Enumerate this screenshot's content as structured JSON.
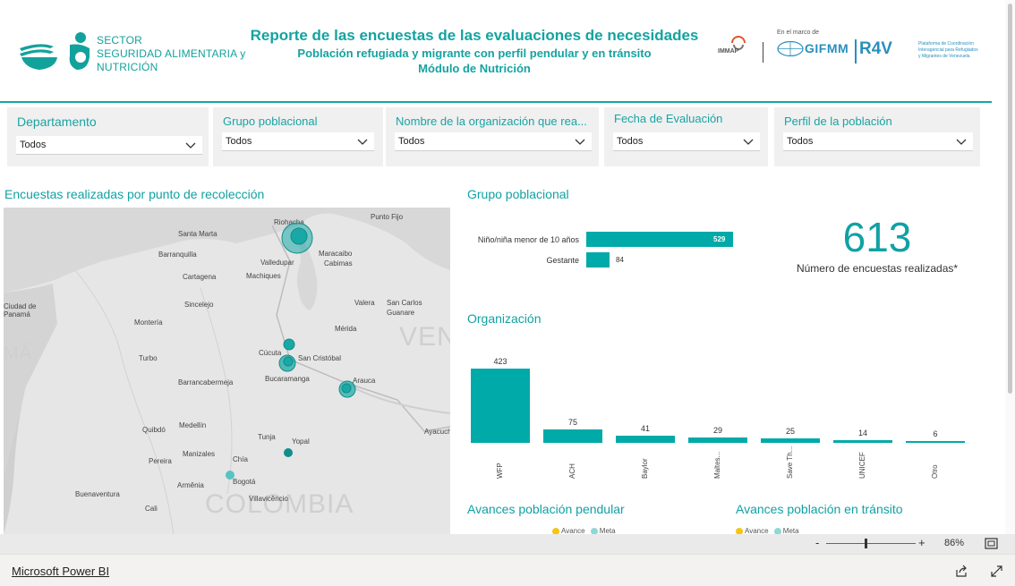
{
  "header": {
    "sector_line1": "SECTOR",
    "sector_line2": "SEGURIDAD ALIMENTARIA y",
    "sector_line3": "NUTRICIÓN",
    "title": "Reporte de las encuestas de las evaluaciones de necesidades",
    "subtitle1": "Población refugiada y migrante con perfil pendular y en tránsito",
    "subtitle2": "Módulo de Nutrición",
    "immap": "IMMAP",
    "en_el_marco": "En el marco de",
    "gifmm": "GIFMM",
    "r4v": "R4V",
    "r4v_sub": "Plataforma de Coordinación Interagencial para Refugiados y Migrantes de Venezuela",
    "brand_color": "#11a3a6"
  },
  "slicers": [
    {
      "title": "Departamento",
      "value": "Todos"
    },
    {
      "title": "Grupo poblacional",
      "value": "Todos"
    },
    {
      "title": "Nombre de la organización que rea...",
      "value": "Todos"
    },
    {
      "title": "Fecha de Evaluación",
      "value": "Todos"
    },
    {
      "title": "Perfil de la población",
      "value": "Todos"
    }
  ],
  "map": {
    "title": "Encuestas realizadas por punto de recolección",
    "cities": [
      "Riohacha",
      "Punto Fijo",
      "Santa Marta",
      "Barranquilla",
      "Maracaibo",
      "Cabimas",
      "Valledupar",
      "Cartagena",
      "Machiques",
      "Ciudad de Panamá",
      "Sincelejo",
      "Valera",
      "San Carlos",
      "Guanare",
      "Montería",
      "Mérida",
      "Cúcuta",
      "Turbo",
      "San Cristóbal",
      "Barrancabermeja",
      "Bucaramanga",
      "Arauca",
      "Quibdó",
      "Medellín",
      "Tunja",
      "Yopal",
      "Ayacucho",
      "Manizales",
      "Pereira",
      "Chía",
      "Bogotá",
      "Armênia",
      "Villavicêncio",
      "Buenaventura",
      "Cali"
    ],
    "country_labels": [
      "COLOMBIA",
      "VEN",
      "MÁ"
    ]
  },
  "grupo": {
    "title": "Grupo poblacional",
    "categories": [
      "Niño/niña menor de 10 años",
      "Gestante"
    ],
    "values": [
      529,
      84
    ]
  },
  "kpi": {
    "value": "613",
    "label": "Número de encuestas realizadas*"
  },
  "org": {
    "title": "Organización"
  },
  "chart_data": {
    "type": "bar",
    "categories": [
      "WFP",
      "ACH",
      "Baylor",
      "Maltes...",
      "Save Th...",
      "UNICEF",
      "Otro"
    ],
    "values": [
      423,
      75,
      41,
      29,
      25,
      14,
      6
    ],
    "title": "Organización",
    "xlabel": "",
    "ylabel": "",
    "color": "#00aaa8"
  },
  "avances": {
    "pendular_title": "Avances población pendular",
    "transito_title": "Avances población en tránsito",
    "legend_avance": "Avance",
    "legend_meta": "Meta",
    "avance_color": "#f5c518",
    "meta_color": "#8dd9d6"
  },
  "zoom": {
    "minus": "-",
    "plus": "+",
    "level": "86%"
  },
  "footer": {
    "link": "Microsoft Power BI"
  }
}
